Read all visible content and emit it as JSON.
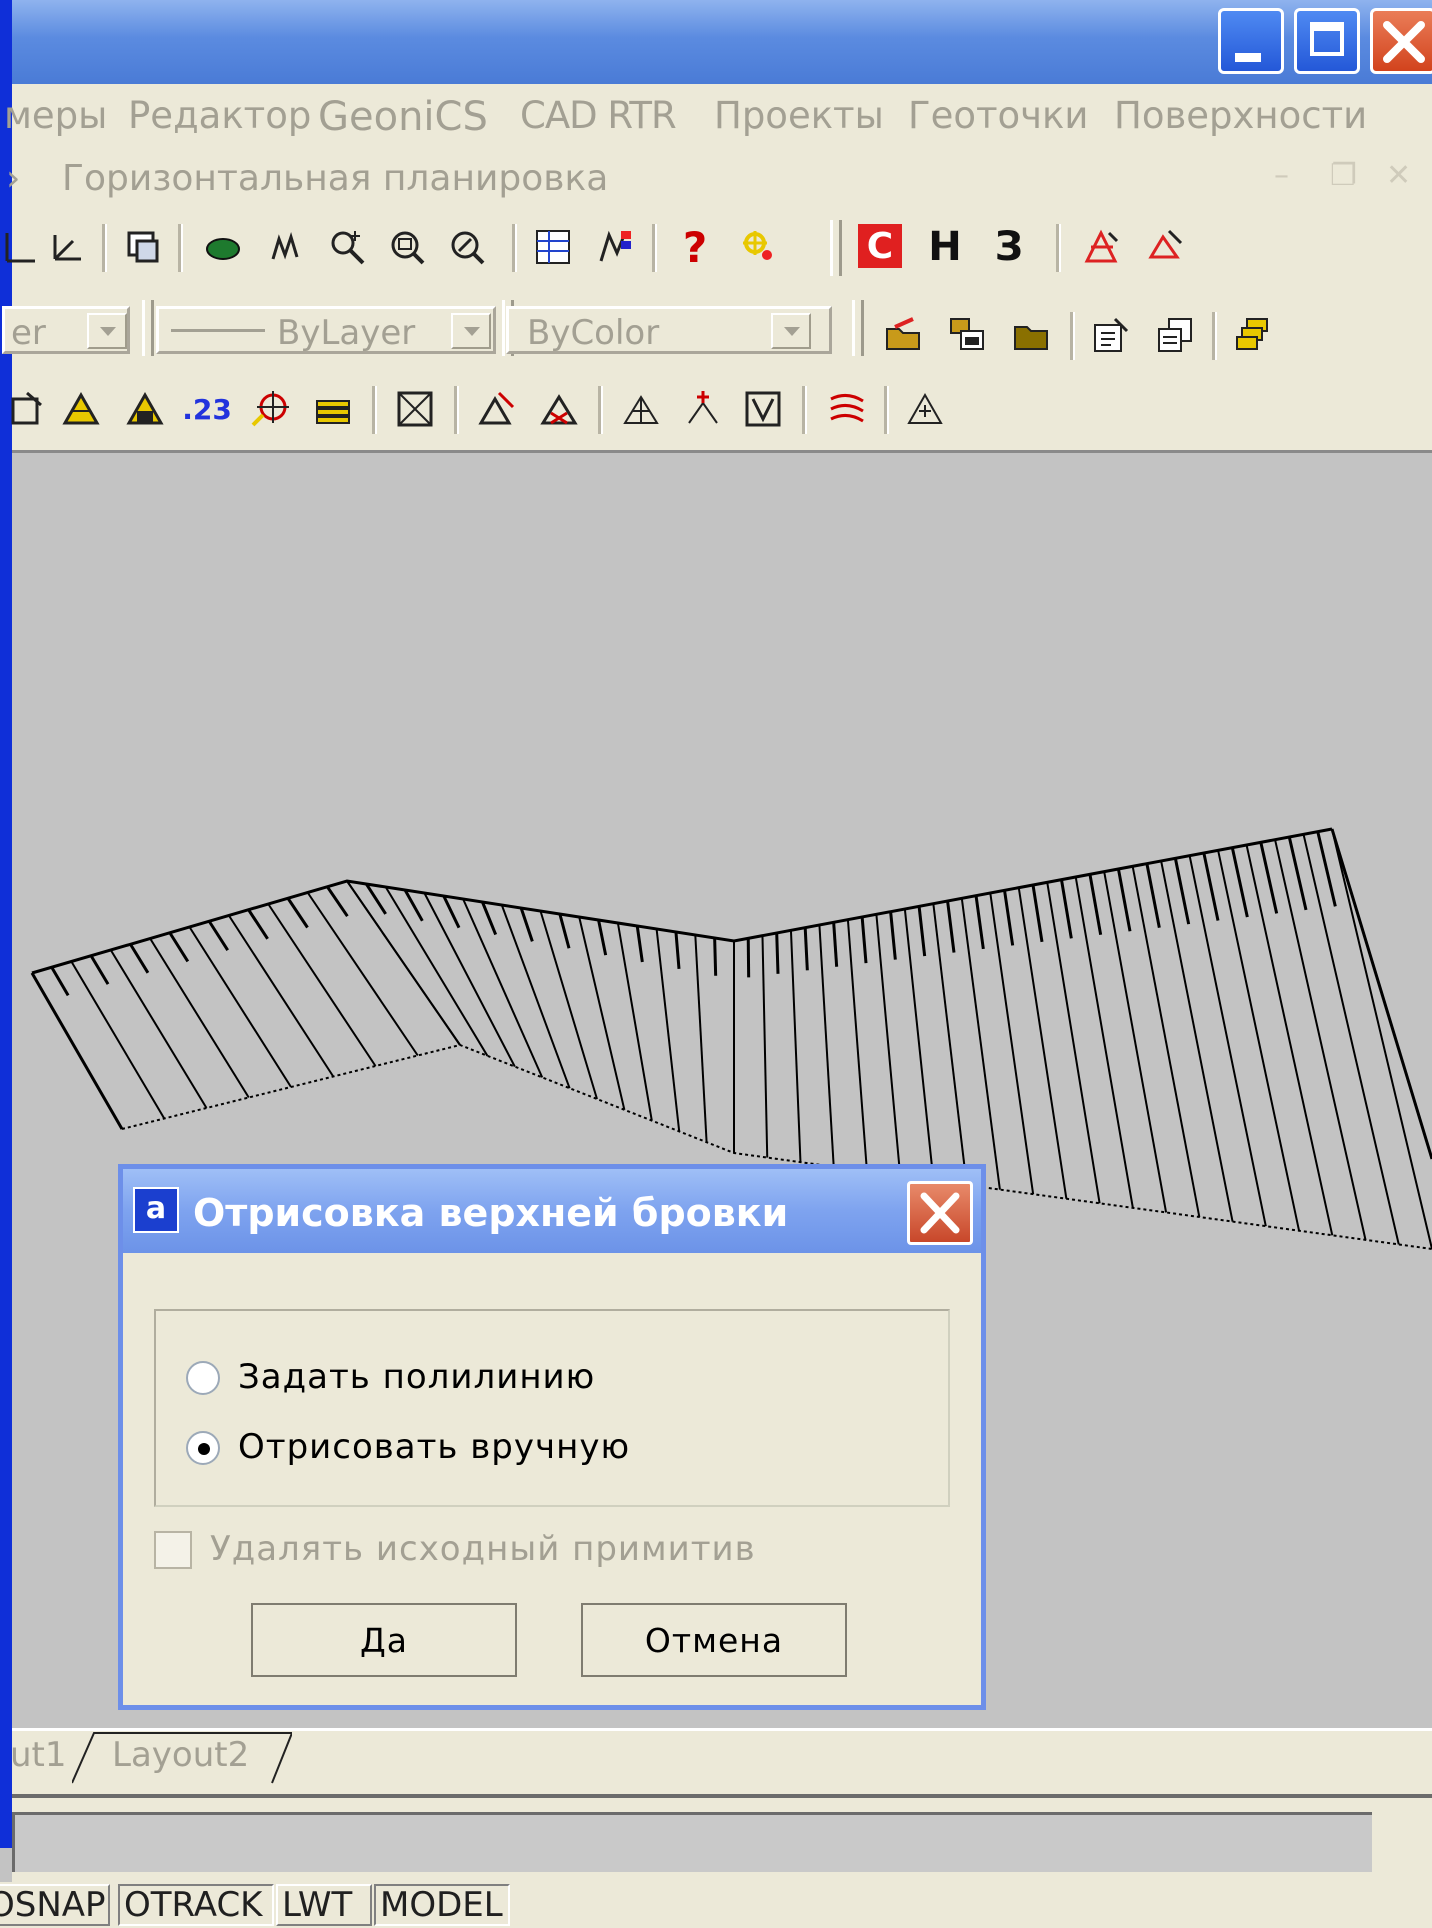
{
  "menubar": {
    "items": [
      {
        "label": "меры"
      },
      {
        "label": "Редактор"
      },
      {
        "label": "GeoniCS"
      },
      {
        "label": "CAD RTR"
      },
      {
        "label": "Проекты"
      },
      {
        "label": "Геоточки"
      },
      {
        "label": "Поверхности"
      }
    ]
  },
  "document": {
    "title": "Горизонтальная планировка"
  },
  "toolbar": {
    "text_buttons": {
      "c": "C",
      "h": "Н",
      "z": "З"
    },
    "question_label": "?",
    "number_label": ".23"
  },
  "properties": {
    "layer_value": "er",
    "linetype_value": "ByLayer",
    "color_value": "ByColor"
  },
  "layout_tabs": [
    {
      "label": "ut1"
    },
    {
      "label": "Layout2"
    }
  ],
  "statusbar": {
    "items": [
      {
        "label": "OSNAP"
      },
      {
        "label": "OTRACK"
      },
      {
        "label": "LWT"
      },
      {
        "label": "MODEL"
      }
    ]
  },
  "dialog": {
    "title": "Отрисовка верхней бровки",
    "options": [
      {
        "label": "Задать полилинию",
        "selected": false
      },
      {
        "label": "Отрисовать вручную",
        "selected": true
      }
    ],
    "checkbox": {
      "label": "Удалять исходный примитив",
      "checked": false,
      "enabled": false
    },
    "ok_label": "Да",
    "cancel_label": "Отмена"
  }
}
